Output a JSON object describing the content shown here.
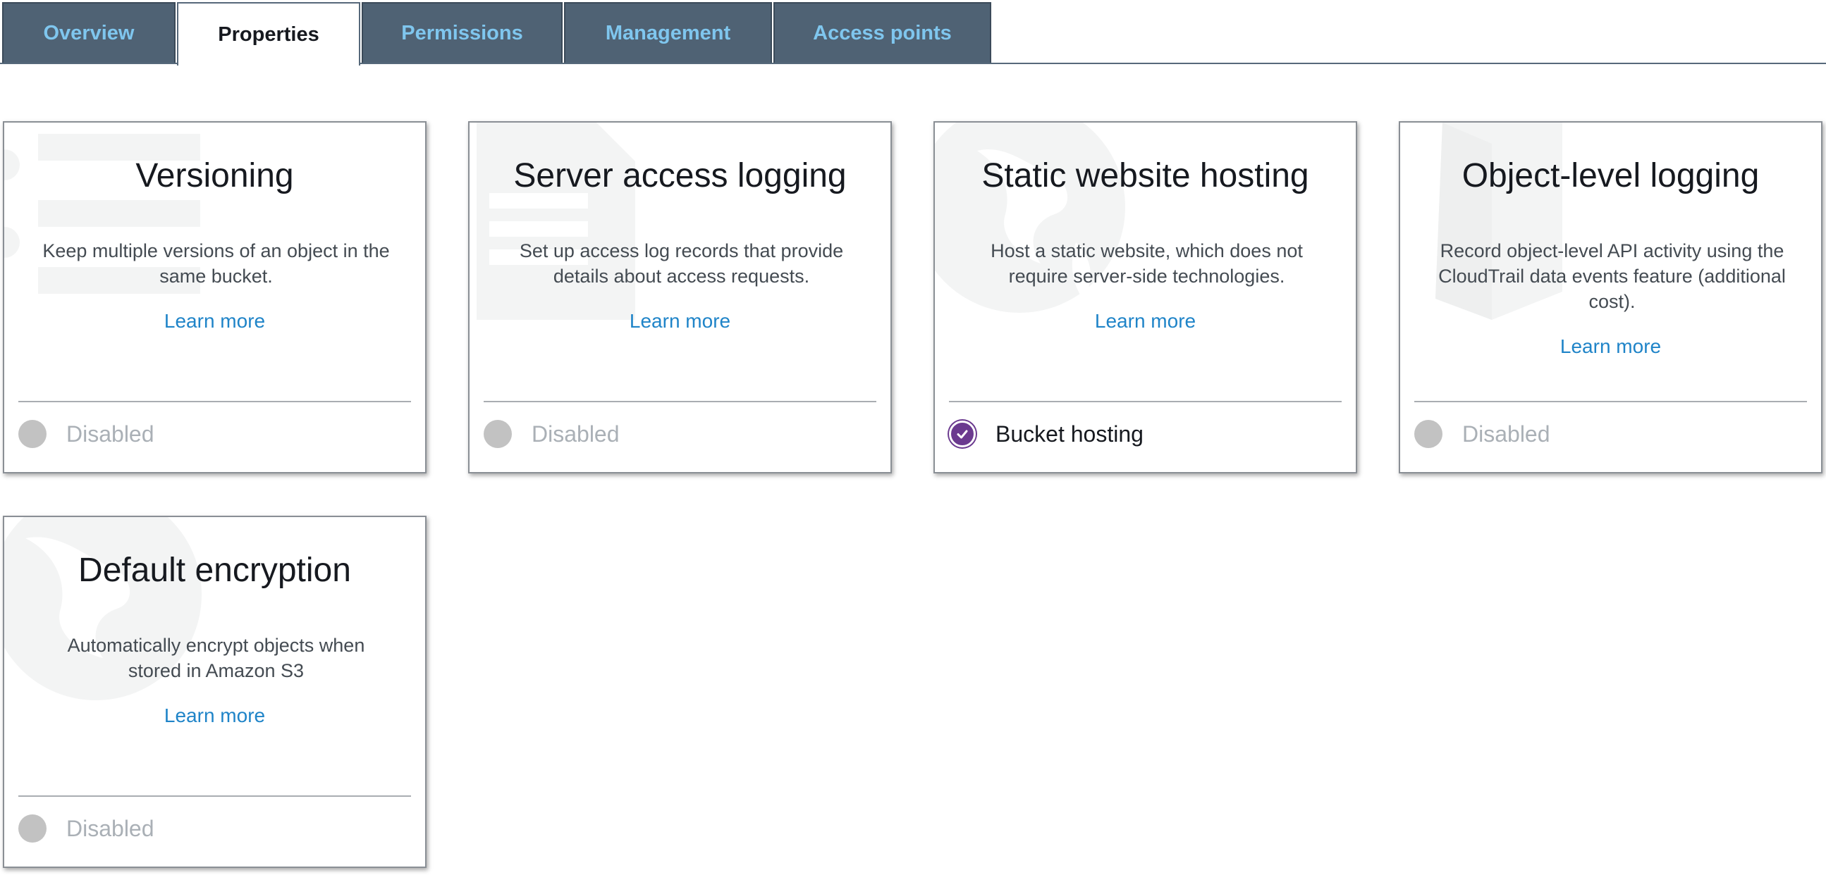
{
  "tabs": [
    {
      "label": "Overview",
      "active": false
    },
    {
      "label": "Properties",
      "active": true
    },
    {
      "label": "Permissions",
      "active": false
    },
    {
      "label": "Management",
      "active": false
    },
    {
      "label": "Access points",
      "active": false
    }
  ],
  "cards": [
    {
      "title": "Versioning",
      "description": "Keep multiple versions of an object in the same bucket.",
      "learn_more": "Learn more",
      "status": "Disabled",
      "enabled": false,
      "bg_icon": "versioning-list-icon"
    },
    {
      "title": "Server access logging",
      "description": "Set up access log records that provide details about access requests.",
      "learn_more": "Learn more",
      "status": "Disabled",
      "enabled": false,
      "bg_icon": "log-document-icon"
    },
    {
      "title": "Static website hosting",
      "description": "Host a static website, which does not require server-side technologies.",
      "learn_more": "Learn more",
      "status": "Bucket hosting",
      "enabled": true,
      "bg_icon": "globe-icon"
    },
    {
      "title": "Object-level logging",
      "description": "Record object-level API activity using the CloudTrail data events feature (additional cost).",
      "learn_more": "Learn more",
      "status": "Disabled",
      "enabled": false,
      "bg_icon": "cube-icon"
    },
    {
      "title": "Default encryption",
      "description": "Automatically encrypt objects when stored in Amazon S3",
      "learn_more": "Learn more",
      "status": "Disabled",
      "enabled": false,
      "bg_icon": "globe-icon"
    }
  ],
  "colors": {
    "tab_bg": "#4f6274",
    "tab_text": "#7fc6ee",
    "link": "#1f84c8",
    "enabled_dot": "#6b3a8f",
    "disabled_dot": "#c2c2c2"
  }
}
